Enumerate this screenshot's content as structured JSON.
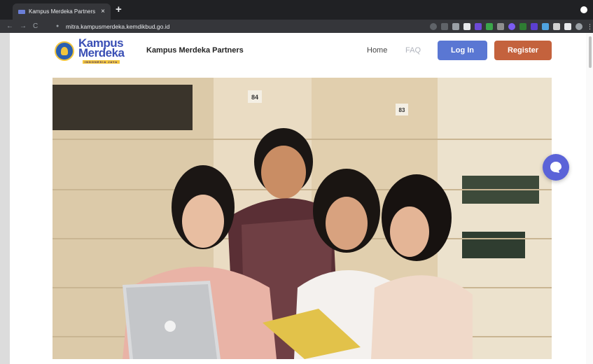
{
  "browser": {
    "tab_title": "Kampus Merdeka Partners",
    "tab_close": "×",
    "new_tab": "+",
    "url": "mitra.kampusmerdeka.kemdikbud.go.id",
    "nav_back": "←",
    "nav_forward": "→",
    "nav_reload": "C"
  },
  "site": {
    "logo_word1": "Kampus",
    "logo_word2": "Merdeka",
    "logo_tagline": "INDONESIA JAYA",
    "name": "Kampus Merdeka Partners",
    "nav": {
      "home": "Home",
      "faq": "FAQ"
    },
    "login_label": "Log In",
    "register_label": "Register"
  },
  "hero": {
    "sign_1": "84",
    "sign_2": "83"
  }
}
